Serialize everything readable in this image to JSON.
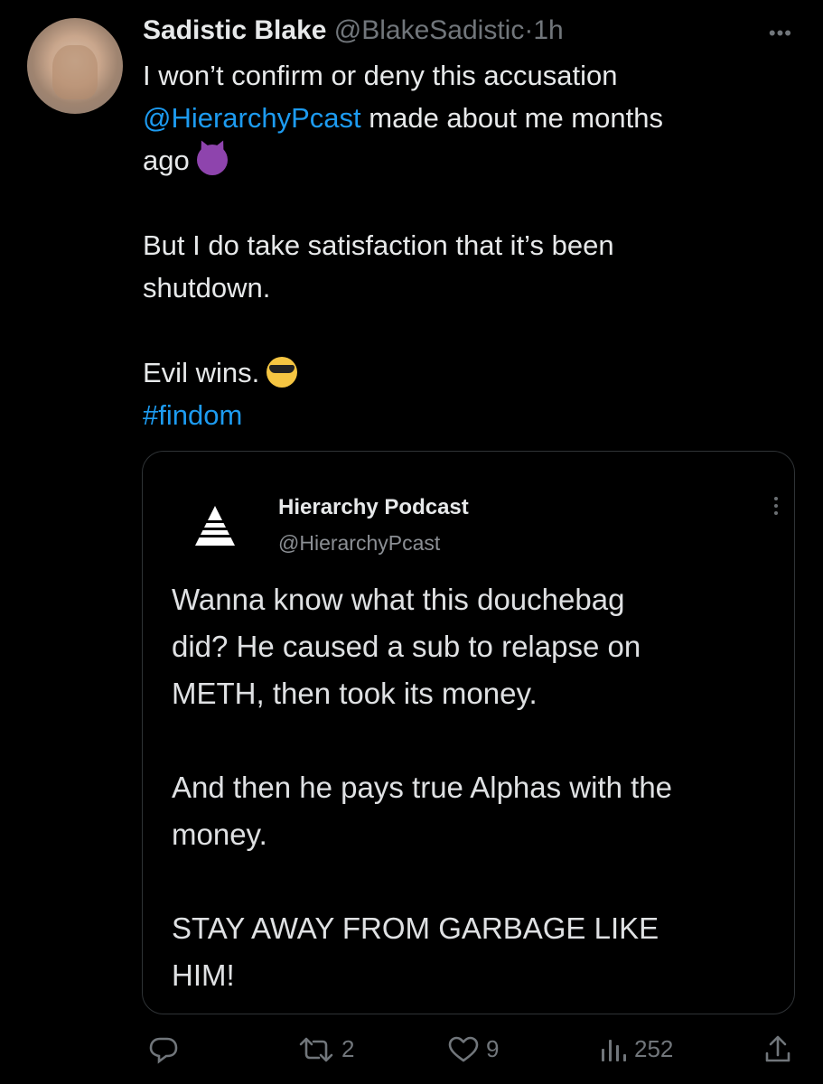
{
  "tweet": {
    "author_name": "Sadistic Blake",
    "author_handle": "@BlakeSadistic",
    "separator": "·",
    "time": "1h",
    "more_label": "•••",
    "text_line1": "I won’t confirm or deny this accusation",
    "mention": "@HierarchyPcast",
    "text_line2_rest": " made about me months",
    "text_line3": "ago",
    "text_para2_line1": "But I do take satisfaction that it’s been",
    "text_para2_line2": "shutdown.",
    "text_para3": "Evil wins.",
    "hashtag": "#findom"
  },
  "quote": {
    "name": "Hierarchy Podcast",
    "handle": "@HierarchyPcast",
    "line1": "Wanna know what this douchebag",
    "line2": "did? He caused a sub to relapse on",
    "line3": "METH, then took its money.",
    "line4": "And then he pays true Alphas with the",
    "line5": "money.",
    "line6": "STAY AWAY FROM GARBAGE LIKE",
    "line7": "HIM!"
  },
  "actions": {
    "reply_count": "",
    "retweet_count": "2",
    "like_count": "9",
    "views_count": "252"
  },
  "icons": {
    "reply": "reply-icon",
    "retweet": "retweet-icon",
    "like": "heart-icon",
    "views": "views-icon",
    "share": "share-icon"
  },
  "colors": {
    "background": "#000000",
    "text": "#e7e9ea",
    "muted": "#71767b",
    "link": "#1d9bf0"
  }
}
